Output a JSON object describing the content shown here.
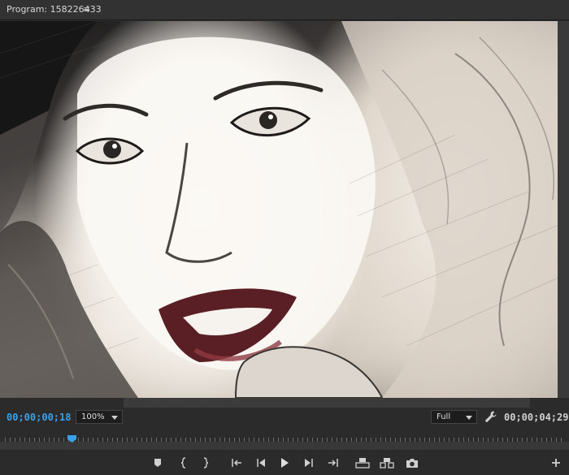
{
  "panel": {
    "title": "Program: 158226433",
    "menu_glyph": "≡"
  },
  "controls": {
    "current_timecode": "00;00;00;18",
    "zoom": "100%",
    "playback_resolution": "Full",
    "duration_timecode": "00;00;04;29"
  },
  "playhead": {
    "position_fraction": 0.12
  },
  "transport": {
    "buttons": [
      {
        "name": "add-marker",
        "icon": "marker-icon"
      },
      {
        "name": "mark-in",
        "icon": "mark-in-icon"
      },
      {
        "name": "mark-out",
        "icon": "mark-out-icon"
      },
      {
        "name": "go-to-in",
        "icon": "go-to-in-icon"
      },
      {
        "name": "step-back",
        "icon": "step-back-icon"
      },
      {
        "name": "play",
        "icon": "play-icon"
      },
      {
        "name": "step-forward",
        "icon": "step-forward-icon"
      },
      {
        "name": "go-to-out",
        "icon": "go-to-out-icon"
      },
      {
        "name": "lift",
        "icon": "lift-icon"
      },
      {
        "name": "extract",
        "icon": "extract-icon"
      },
      {
        "name": "export-frame",
        "icon": "camera-icon"
      },
      {
        "name": "button-editor",
        "icon": "plus-icon"
      }
    ]
  },
  "colors": {
    "panel_bg": "#2b2b2b",
    "timecode_accent": "#3aa0e8",
    "playhead": "#3aa0e8"
  }
}
